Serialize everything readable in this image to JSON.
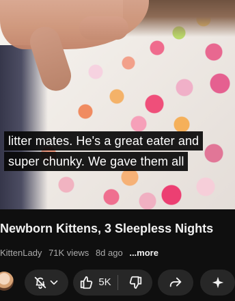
{
  "video": {
    "caption_lines": [
      "litter mates. He's a great eater and",
      "super chunky. We gave them all"
    ]
  },
  "details": {
    "title": "Newborn Kittens, 3 Sleepless Nights",
    "channel": "KittenLady",
    "views": "71K views",
    "age": "8d ago",
    "more": "...more"
  },
  "actions": {
    "like_count": "5K"
  },
  "icons": {
    "bell": "bell-slash-icon",
    "chevron": "chevron-down-icon",
    "like": "thumbs-up-icon",
    "dislike": "thumbs-down-icon",
    "share": "share-icon",
    "remix": "sparkle-icon"
  },
  "colors": {
    "background": "#0f0f0f",
    "pill": "#272727",
    "text": "#f1f1f1",
    "secondary_text": "#aaaaaa"
  }
}
